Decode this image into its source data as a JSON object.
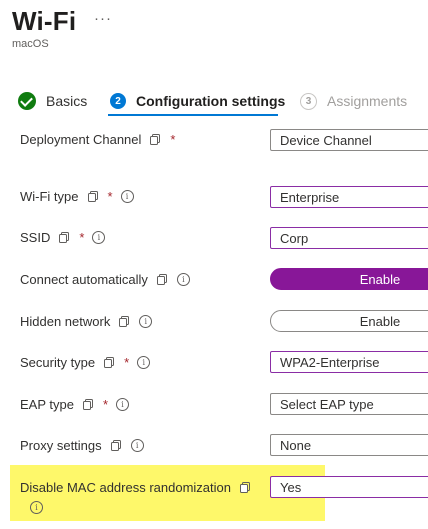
{
  "header": {
    "title": "Wi-Fi",
    "more": "···",
    "subtitle": "macOS"
  },
  "tabs": [
    {
      "label": "Basics",
      "state": "complete"
    },
    {
      "number": "2",
      "label": "Configuration settings",
      "state": "active"
    },
    {
      "number": "3",
      "label": "Assignments",
      "state": "disabled"
    }
  ],
  "settings": {
    "deployment_channel": {
      "label": "Deployment Channel",
      "required": "*",
      "value": "Device Channel"
    },
    "wifi_type": {
      "label": "Wi-Fi type",
      "required": "*",
      "value": "Enterprise"
    },
    "ssid": {
      "label": "SSID",
      "required": "*",
      "value": "Corp"
    },
    "connect_automatically": {
      "label": "Connect automatically",
      "value": "Enable"
    },
    "hidden_network": {
      "label": "Hidden network",
      "value": "Enable"
    },
    "security_type": {
      "label": "Security type",
      "required": "*",
      "value": "WPA2-Enterprise"
    },
    "eap_type": {
      "label": "EAP type",
      "required": "*",
      "value": "Select EAP type"
    },
    "proxy_settings": {
      "label": "Proxy settings",
      "value": "None"
    },
    "disable_mac_randomization": {
      "label": "Disable MAC address randomization",
      "value": "Yes"
    }
  },
  "colors": {
    "accent": "#0078d4",
    "toggle_on": "#881798",
    "highlight": "#fef86a",
    "success": "#107c10",
    "required": "#a4262c"
  }
}
